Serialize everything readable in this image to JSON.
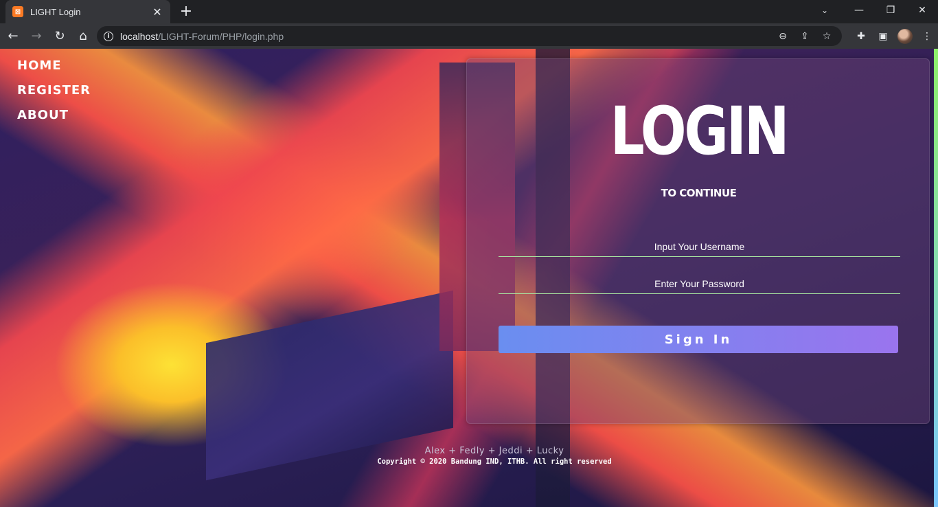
{
  "browser": {
    "tab_title": "LIGHT Login",
    "tab_favicon": "xampp-icon",
    "url_host": "localhost",
    "url_path": "/LIGHT-Forum/PHP/login.php"
  },
  "nav": {
    "items": [
      {
        "label": "Home"
      },
      {
        "label": "Register"
      },
      {
        "label": "About"
      }
    ]
  },
  "login": {
    "title": "LOGIN",
    "subtitle": "TO CONTINUE",
    "username_placeholder": "Input Your Username",
    "password_placeholder": "Enter Your Password",
    "button_label": "Sign In"
  },
  "footer": {
    "names": "Alex + Fedly + Jeddi + Lucky",
    "copyright": "Copyright © 2020 Bandung IND, ITHB. All right reserved"
  },
  "colors": {
    "button_gradient_start": "#6a8ef0",
    "button_gradient_end": "#9a74ee",
    "field_underline": "#a8e6a0"
  }
}
